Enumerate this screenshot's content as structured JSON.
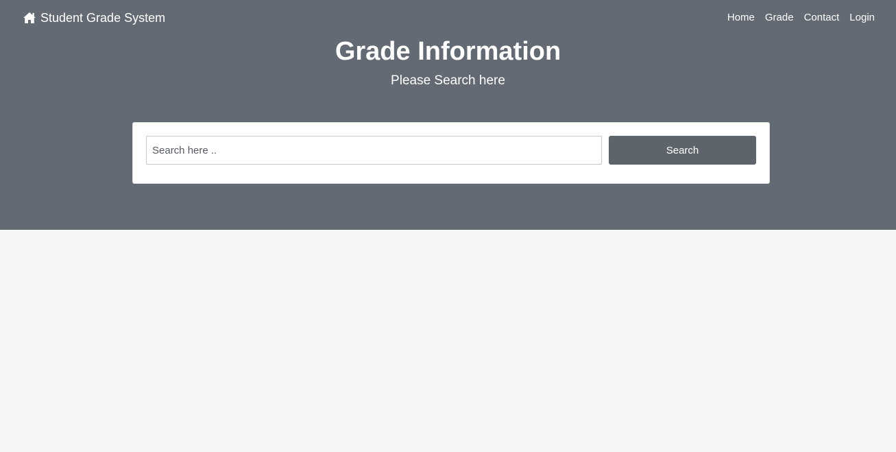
{
  "navbar": {
    "brand_icon": "home-icon",
    "brand_label": "Student Grade System",
    "links": [
      {
        "label": "Home"
      },
      {
        "label": "Grade"
      },
      {
        "label": "Contact"
      },
      {
        "label": "Login"
      }
    ]
  },
  "hero": {
    "title": "Grade Information",
    "subtitle": "Please Search here"
  },
  "search": {
    "placeholder": "Search here ..",
    "value": "",
    "button_label": "Search"
  },
  "colors": {
    "hero_background": "#636a73",
    "button_background": "#5d646c",
    "page_background": "#f6f6f6"
  }
}
